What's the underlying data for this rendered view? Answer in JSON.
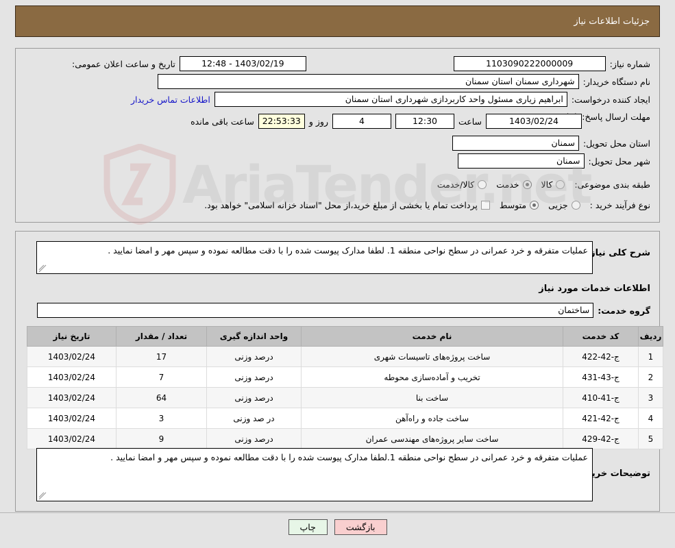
{
  "header": {
    "title": "جزئیات اطلاعات نیاز"
  },
  "top_form": {
    "need_number_label": "شماره نیاز:",
    "need_number_value": "1103090222000009",
    "announce_datetime_label": "تاریخ و ساعت اعلان عمومی:",
    "announce_datetime_value": "1403/02/19 - 12:48",
    "buyer_org_label": "نام دستگاه خریدار:",
    "buyer_org_value": "شهرداری سمنان استان سمنان",
    "requester_label": "ایجاد کننده درخواست:",
    "requester_value": "ابراهیم زیاری مسئول واحد کاربردازی شهرداری استان سمنان",
    "contact_link": "اطلاعات تماس خریدار",
    "deadline_label": "مهلت ارسال پاسخ: تا تاریخ:",
    "deadline_date": "1403/02/24",
    "deadline_hour_label": "ساعت",
    "deadline_hour": "12:30",
    "remaining_days": "4",
    "remaining_days_suffix": "روز و",
    "remaining_time": "22:53:33",
    "remaining_time_suffix": "ساعت باقی مانده",
    "province_label": "استان محل تحویل:",
    "province_value": "سمنان",
    "city_label": "شهر محل تحویل:",
    "city_value": "سمنان",
    "category_label": "طبقه بندی موضوعی:",
    "category_options": [
      {
        "label": "کالا",
        "selected": false
      },
      {
        "label": "خدمت",
        "selected": true
      },
      {
        "label": "کالا/خدمت",
        "selected": false
      }
    ],
    "process_label": "نوع فرآیند خرید :",
    "process_options": [
      {
        "label": "جزیی",
        "selected": false
      },
      {
        "label": "متوسط",
        "selected": true
      }
    ],
    "treasury_checkbox_checked": false,
    "treasury_text": "پرداخت تمام یا بخشی از مبلغ خرید،از محل \"اسناد خزانه اسلامی\" خواهد بود."
  },
  "main": {
    "overview_label": "شرح کلی نیاز:",
    "overview_value": "عملیات متفرقه و خرد عمرانی در سطح نواحی منطقه 1. لطفا مدارک پیوست شده را با دقت مطالعه نموده و سپس مهر و امضا نمایید .",
    "services_section_title": "اطلاعات خدمات مورد نیاز",
    "service_group_label": "گروه خدمت:",
    "service_group_value": "ساختمان",
    "buyer_notes_label": "توضیحات خریدار:",
    "buyer_notes_value": "عملیات متفرقه و خرد عمرانی در سطح نواحی منطقه 1.لطفا مدارک پیوست شده را با دقت مطالعه نموده و سپس مهر و امضا نمایید ."
  },
  "table": {
    "columns": [
      "ردیف",
      "کد خدمت",
      "نام خدمت",
      "واحد اندازه گیری",
      "تعداد / مقدار",
      "تاریخ نیاز"
    ],
    "rows": [
      {
        "row": "1",
        "code": "ج-42-422",
        "name": "ساخت پروژه‌های تاسیسات شهری",
        "unit": "درصد وزنی",
        "qty": "17",
        "date": "1403/02/24"
      },
      {
        "row": "2",
        "code": "ج-43-431",
        "name": "تخریب و آماده‌سازی محوطه",
        "unit": "درصد وزنی",
        "qty": "7",
        "date": "1403/02/24"
      },
      {
        "row": "3",
        "code": "ج-41-410",
        "name": "ساخت بنا",
        "unit": "درصد وزنی",
        "qty": "64",
        "date": "1403/02/24"
      },
      {
        "row": "4",
        "code": "ج-42-421",
        "name": "ساخت جاده و راه‌آهن",
        "unit": "در صد وزنی",
        "qty": "3",
        "date": "1403/02/24"
      },
      {
        "row": "5",
        "code": "ج-42-429",
        "name": "ساخت سایر پروژه‌های مهندسی عمران",
        "unit": "درصد وزنی",
        "qty": "9",
        "date": "1403/02/24"
      }
    ]
  },
  "footer": {
    "print_label": "چاپ",
    "back_label": "بازگشت"
  },
  "watermark": {
    "text": "AriaTender.net"
  },
  "colors": {
    "header_bg": "#8a6a42",
    "page_bg": "#e4e4e4",
    "link": "#1414c8",
    "print_btn": "#e7f6e7",
    "back_btn": "#f9cfcf",
    "countdown_bg": "#ffffdd",
    "table_header_bg": "#c3c3c3"
  }
}
